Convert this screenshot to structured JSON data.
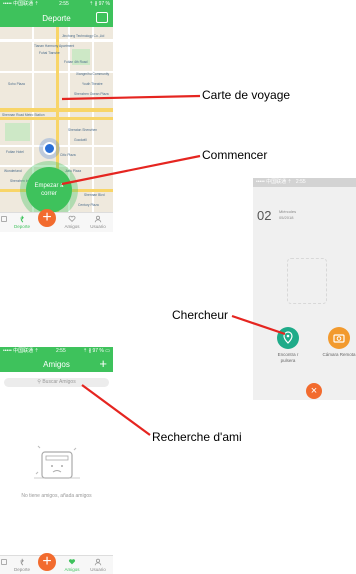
{
  "map_screen": {
    "status": {
      "carrier": "••••• 中国联通 ⇡",
      "time": "2:55",
      "battery": "⇡ ∦ 97 %"
    },
    "title": "Deporte",
    "start_button": "Empezar a correr",
    "pois": [
      "Jinchong Technology Co.,Ltd",
      "Tianan Harmony Apartment",
      "Fuhai Tianshe",
      "Futian 4th Road",
      "Xiangmihu Community",
      "Youth Theatre",
      "Shenzhen Ocean Plaza",
      "Soho Plaza",
      "Shennan Road Metro Station",
      "Sheraton Shenzhen",
      "Goodwill",
      "Citic Plaza",
      "Futian Hotel",
      "Wonderland",
      "Jiafu Plaza",
      "Shenzhen Investment Plaza",
      "Shennan Blvd",
      "Century Plaza"
    ],
    "tabs": [
      "",
      "Deporte",
      "",
      "Amigos",
      "Usuario"
    ],
    "plus_label": "+"
  },
  "finder_screen": {
    "status": {
      "carrier": "••••• 中国联通 ⇡",
      "time": "2:55"
    },
    "day": "02",
    "weekday": "Miércoles",
    "month_year": "05/2018",
    "finder_label": "Encontra r pulsera",
    "camera_label": "Cámara Remota",
    "close_label": "×"
  },
  "friends_screen": {
    "status": {
      "carrier": "••••• 中国联通 ⇡",
      "time": "2:55",
      "battery": "⇡ ∦ 97 % ▭"
    },
    "title": "Amigos",
    "add_label": "+",
    "search_placeholder": "Buscar Amigos",
    "empty_text": "No tiene amigos, añada amigos",
    "tabs": [
      "",
      "Deporte",
      "",
      "Amigos",
      "Usuario"
    ],
    "plus_label": "+"
  },
  "callouts": {
    "map": "Carte de voyage",
    "start": "Commencer",
    "finder": "Chercheur",
    "search": "Recherche d'ami"
  },
  "colors": {
    "primary": "#3ec25c",
    "accent": "#f26b2e",
    "callout_line": "#e52520",
    "finder": "#1fab89",
    "camera": "#f29a2e"
  }
}
